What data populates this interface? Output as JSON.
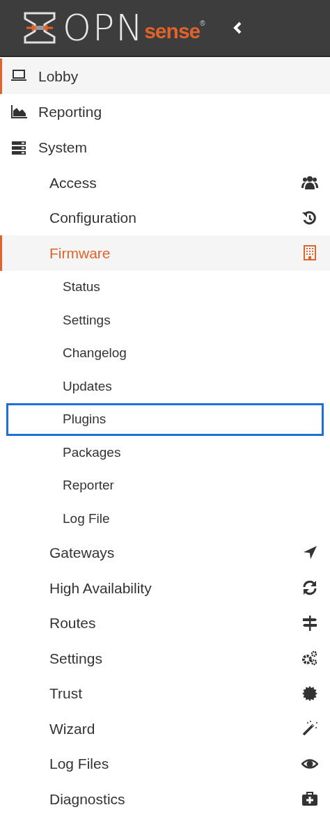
{
  "header": {
    "logo_main": "OPN",
    "logo_accent": "sense",
    "logo_mark": "®"
  },
  "menu": [
    {
      "label": "Lobby",
      "selected": true
    },
    {
      "label": "Reporting",
      "selected": false
    },
    {
      "label": "System",
      "selected": false,
      "children": [
        {
          "label": "Access",
          "selected": false
        },
        {
          "label": "Configuration",
          "selected": false
        },
        {
          "label": "Firmware",
          "selected": true,
          "children": [
            {
              "label": "Status",
              "focused": false
            },
            {
              "label": "Settings",
              "focused": false
            },
            {
              "label": "Changelog",
              "focused": false
            },
            {
              "label": "Updates",
              "focused": false
            },
            {
              "label": "Plugins",
              "focused": true
            },
            {
              "label": "Packages",
              "focused": false
            },
            {
              "label": "Reporter",
              "focused": false
            },
            {
              "label": "Log File",
              "focused": false
            }
          ]
        },
        {
          "label": "Gateways",
          "selected": false
        },
        {
          "label": "High Availability",
          "selected": false
        },
        {
          "label": "Routes",
          "selected": false
        },
        {
          "label": "Settings",
          "selected": false
        },
        {
          "label": "Trust",
          "selected": false
        },
        {
          "label": "Wizard",
          "selected": false
        },
        {
          "label": "Log Files",
          "selected": false
        },
        {
          "label": "Diagnostics",
          "selected": false
        }
      ]
    }
  ]
}
